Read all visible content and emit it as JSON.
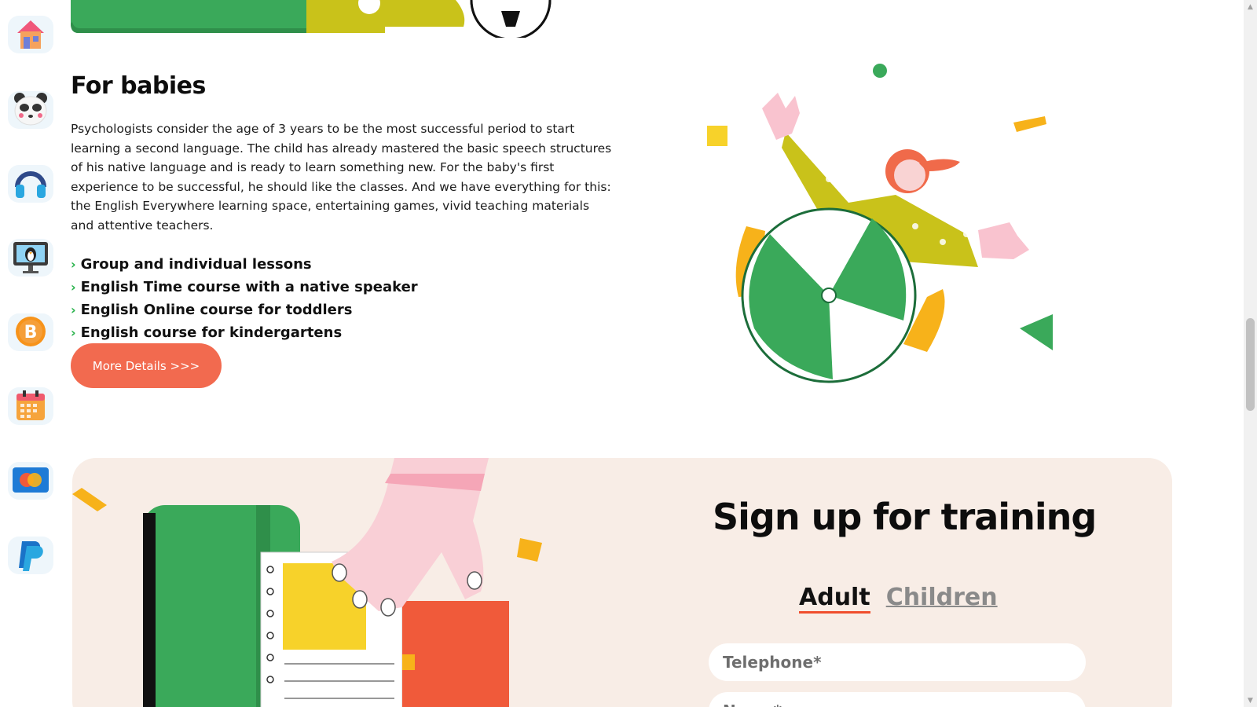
{
  "rail": {
    "items": [
      {
        "icon": "home-icon"
      },
      {
        "icon": "panda-icon"
      },
      {
        "icon": "headphones-icon"
      },
      {
        "icon": "monitor-penguin-icon"
      },
      {
        "icon": "bitcoin-icon"
      },
      {
        "icon": "calendar-icon"
      },
      {
        "icon": "mastercard-icon"
      },
      {
        "icon": "paypal-icon"
      }
    ]
  },
  "babies": {
    "title": "For babies",
    "text": "Psychologists consider the age of 3 years to be the most successful period to start learning a second language. The child has already mastered the basic speech structures of his native language and is ready to learn something new. For the baby's first experience to be successful, he should like the classes. And we have everything for this: the English Everywhere learning space, entertaining games, vivid teaching materials and attentive teachers.",
    "features": [
      "Group and individual lessons",
      "English Time course with a native speaker",
      "English Online course for toddlers",
      "English course for kindergartens"
    ],
    "more_label": "More Details >>>"
  },
  "signup": {
    "title": "Sign up for training",
    "tabs": [
      "Adult",
      "Children"
    ],
    "active_tab": "Adult",
    "telephone_placeholder": "Telephone*",
    "name_placeholder": "Name*"
  },
  "colors": {
    "accent": "#f26a4f",
    "green": "#27b24a",
    "panel_bg": "#f8ede6"
  }
}
